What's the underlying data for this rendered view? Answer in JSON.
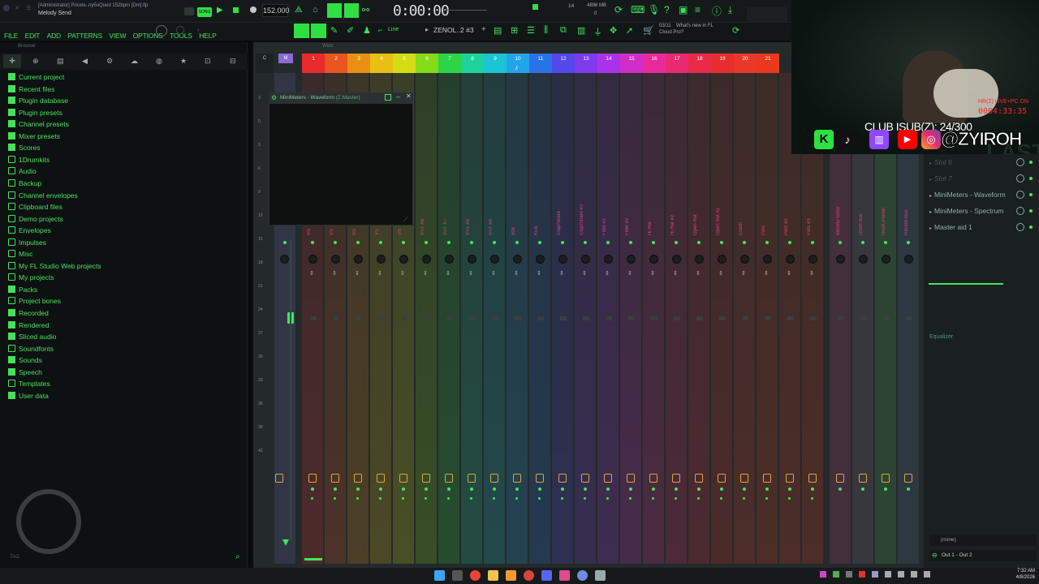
{
  "titlebar": {
    "window_title": "[Administrator] Pricele..ny5oQued  152bpm [Dm].flp",
    "subtitle": "Melody Send",
    "tempo": "152.000",
    "time": "0:00:00",
    "cpu": "14",
    "memory": "4896 MB",
    "memory_sub": "0",
    "news_date": "03/11",
    "news_text": "What's new in FL",
    "news_text2": "Cloud Pro?"
  },
  "menu": {
    "items": [
      "FILE",
      "EDIT",
      "ADD",
      "PATTERNS",
      "VIEW",
      "OPTIONS",
      "TOOLS",
      "HELP"
    ],
    "snap": "Line",
    "pattern": "ZENOL..2 #3",
    "plus": "+"
  },
  "browser": {
    "label": "Browser",
    "items": [
      {
        "label": "Current project",
        "icon": "solid"
      },
      {
        "label": "Recent files",
        "icon": "solid"
      },
      {
        "label": "Plugin database",
        "icon": "solid"
      },
      {
        "label": "Plugin presets",
        "icon": "solid"
      },
      {
        "label": "Channel presets",
        "icon": "solid"
      },
      {
        "label": "Mixer presets",
        "icon": "solid"
      },
      {
        "label": "Scores",
        "icon": "solid"
      },
      {
        "label": "1Drumkits",
        "icon": "folder"
      },
      {
        "label": "Audio",
        "icon": "folder"
      },
      {
        "label": "Backup",
        "icon": "folder"
      },
      {
        "label": "Channel envelopes",
        "icon": "folder"
      },
      {
        "label": "Clipboard files",
        "icon": "folder"
      },
      {
        "label": "Demo projects",
        "icon": "folder"
      },
      {
        "label": "Envelopes",
        "icon": "folder"
      },
      {
        "label": "Impulses",
        "icon": "folder"
      },
      {
        "label": "Misc",
        "icon": "folder"
      },
      {
        "label": "My FL Studio Web projects",
        "icon": "folder"
      },
      {
        "label": "My projects",
        "icon": "folder"
      },
      {
        "label": "Packs",
        "icon": "solid"
      },
      {
        "label": "Project bones",
        "icon": "folder"
      },
      {
        "label": "Recorded",
        "icon": "solid"
      },
      {
        "label": "Rendered",
        "icon": "solid"
      },
      {
        "label": "Sliced audio",
        "icon": "solid"
      },
      {
        "label": "Soundfonts",
        "icon": "folder"
      },
      {
        "label": "Sounds",
        "icon": "solid"
      },
      {
        "label": "Speech",
        "icon": "solid"
      },
      {
        "label": "Templates",
        "icon": "folder"
      },
      {
        "label": "User data",
        "icon": "solid"
      }
    ],
    "footer_tag": "TAG"
  },
  "mixer": {
    "view_label": "Wide",
    "header_c": "C",
    "header_m": "M",
    "channel_numbers": [
      "1",
      "2",
      "3",
      "4",
      "5",
      "6",
      "7",
      "8",
      "9",
      "10",
      "11",
      "12",
      "13",
      "14",
      "15",
      "16",
      "17",
      "18",
      "19",
      "20",
      "21"
    ],
    "channel_colors": [
      "#ff2b2b",
      "#ff5a1e",
      "#ff9b12",
      "#ffcf10",
      "#e9f012",
      "#8fee16",
      "#2ee84a",
      "#1ee6a7",
      "#18d6e6",
      "#22b1ff",
      "#2a7bff",
      "#5a4bff",
      "#8a3cff",
      "#b834ff",
      "#e12fd8",
      "#ff2aa6",
      "#ff2a78",
      "#ff2a4a",
      "#ff2d2d",
      "#ff3a2a",
      "#ff3a1c"
    ],
    "strip_labels": [
      "VS",
      "VS",
      "VS",
      "VS",
      "VS",
      "VST #6",
      "VST #7",
      "VST #8",
      "VST #9",
      "808",
      "Kick",
      "Clap/Snare",
      "Clap/Snare #2",
      "Filler #1",
      "Filler #2",
      "Hi Hat",
      "Hi Hat #2",
      "Open Hat",
      "Open Hat #2",
      "Crash",
      "Perc",
      "Perc #2",
      "Perc #3"
    ],
    "bus_labels": [
      "Melody Send",
      "Drum Bus",
      "Drum Parrell",
      "Reverb Bus"
    ],
    "scale_values": [
      "3",
      "0",
      "3",
      "6",
      "9",
      "12",
      "15",
      "18",
      "21",
      "24",
      "27",
      "30",
      "33",
      "36",
      "39",
      "42"
    ]
  },
  "waveform_window": {
    "title": "MiniMeters - Waveform",
    "subtitle": "(Z Master)"
  },
  "right_panel": {
    "slots": [
      "Slot 6",
      "Slot 7",
      "MiniMeters - Waveform",
      "MiniMeters - Spectrum",
      "Master aid 1"
    ],
    "equalizer_label": "Equalizer",
    "input_label": "(none)",
    "output_label": "Out 1 - Out 2"
  },
  "webcam": {
    "overlay_top": "HR(2) LIVE+PC ON",
    "timer": "0004:33:35",
    "sub_count": "CLUB ISUB(Z): 24/300",
    "handle": "@ZYIROH",
    "bg_text": "LAST"
  },
  "taskbar": {
    "time": "7:32 AM",
    "date": "4/8/2026"
  },
  "colors": {
    "accent_green": "#3ee35a",
    "gold": "#e0a53a"
  }
}
